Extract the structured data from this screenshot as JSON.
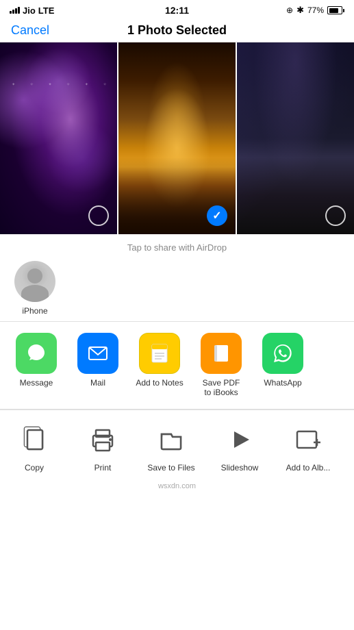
{
  "statusBar": {
    "carrier": "Jio",
    "network": "LTE",
    "time": "12:11",
    "batteryPercent": "77%"
  },
  "navBar": {
    "cancelLabel": "Cancel",
    "title": "1 Photo Selected"
  },
  "airdrop": {
    "label": "Tap to share with AirDrop",
    "contacts": [
      {
        "name": "iPhone",
        "selected": false
      }
    ]
  },
  "shareActions": [
    {
      "label": "Message",
      "iconColor": "green",
      "icon": "💬"
    },
    {
      "label": "Mail",
      "iconColor": "blue",
      "icon": "✉️"
    },
    {
      "label": "Add to Notes",
      "iconColor": "yellow",
      "icon": "📝"
    },
    {
      "label": "Save PDF\nto iBooks",
      "iconColor": "orange",
      "icon": "📖"
    },
    {
      "label": "WhatsApp",
      "iconColor": "whatsapp-green",
      "icon": "📱"
    }
  ],
  "bottomActions": [
    {
      "label": "Copy",
      "icon": "copy"
    },
    {
      "label": "Print",
      "icon": "print"
    },
    {
      "label": "Save to Files",
      "icon": "files"
    },
    {
      "label": "Slideshow",
      "icon": "play"
    },
    {
      "label": "Add to Alb...",
      "icon": "add-album"
    }
  ],
  "watermark": "wsxdn.com"
}
